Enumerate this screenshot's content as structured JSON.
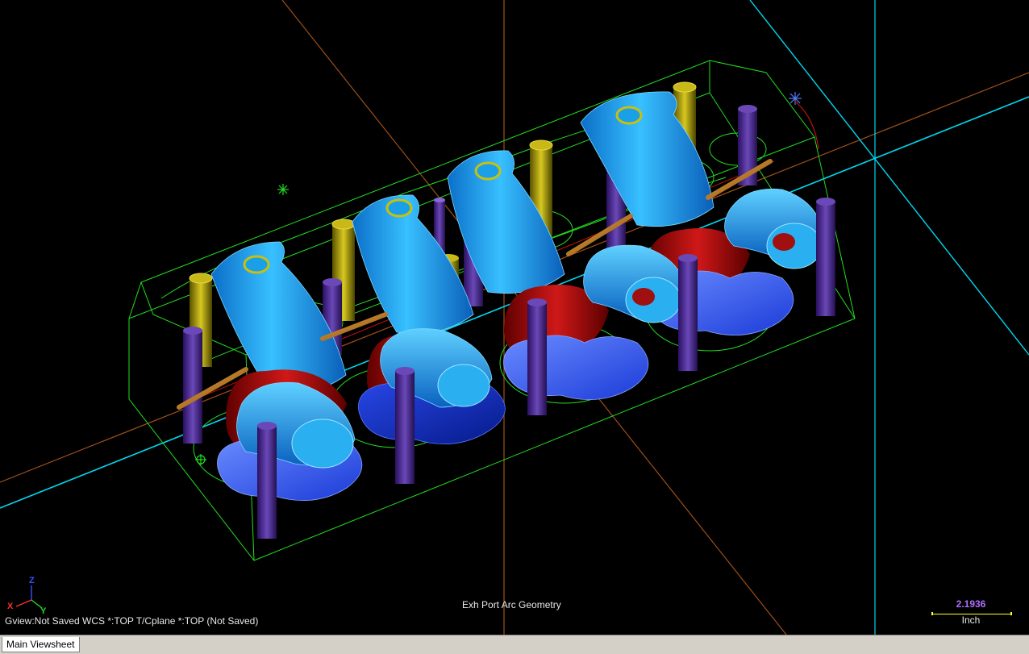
{
  "viewport": {
    "background": "#000000",
    "status_text": "Gview:Not Saved   WCS *:TOP   T/Cplane *:TOP (Not Saved)",
    "level_name": "Exh Port Arc Geometry",
    "scale": {
      "value": "2.1936",
      "unit": "Inch"
    },
    "triad": {
      "x": "X",
      "y": "Y",
      "z": "Z"
    }
  },
  "tabs": [
    {
      "label": "Main Viewsheet",
      "active": true
    }
  ],
  "colors": {
    "wireframe": "#22dd22",
    "port_light_blue": "#1e9ee8",
    "port_dark_blue": "#1033c8",
    "seat_blue": "#3a62f0",
    "valve_red": "#b01010",
    "stud_purple": "#4a2a8a",
    "gold_tube": "#a8a010",
    "axis_cyan": "#00d8f0",
    "axis_orange": "#a05018"
  }
}
